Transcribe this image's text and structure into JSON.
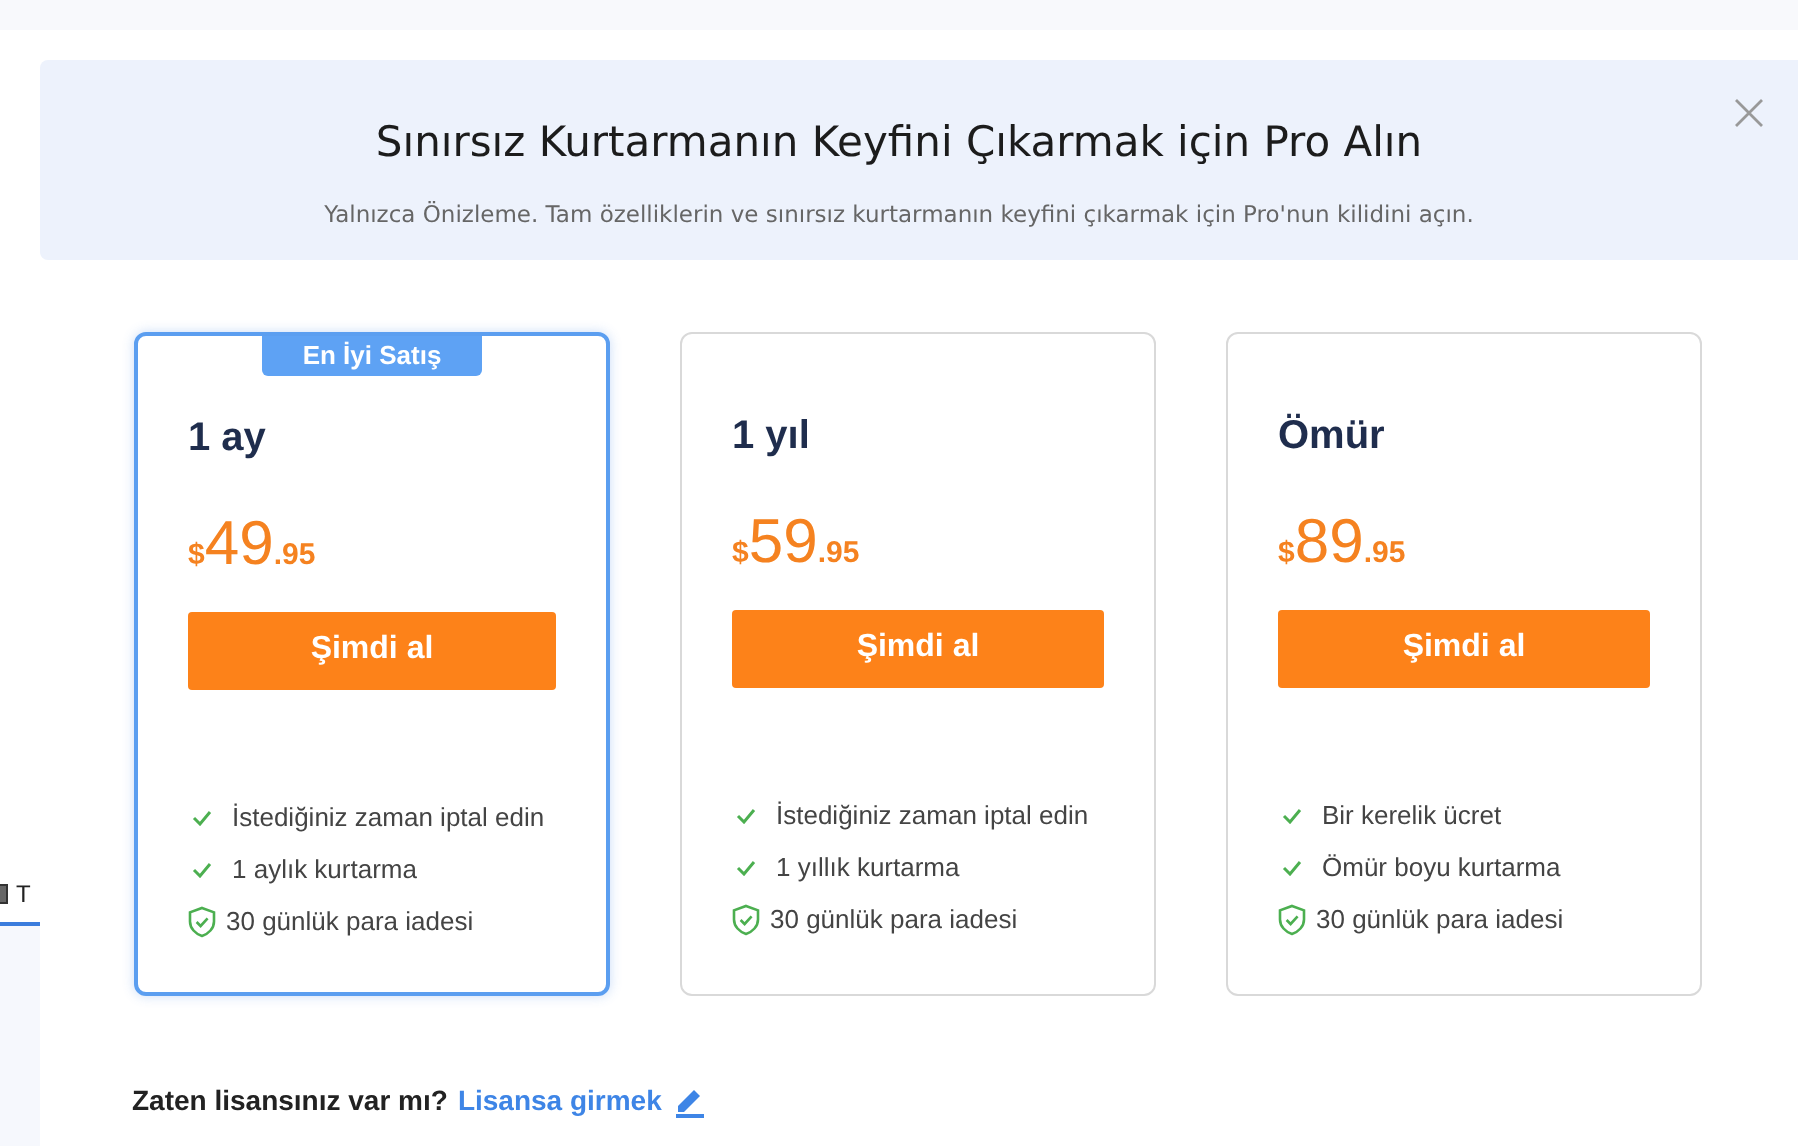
{
  "background": {
    "tab_label": "T"
  },
  "banner": {
    "title": "Sınırsız Kurtarmanın Keyfini Çıkarmak için Pro Alın",
    "subtitle": "Yalnızca Önizleme. Tam özelliklerin ve sınırsız kurtarmanın keyfini çıkarmak için Pro'nun kilidini açın."
  },
  "plans": [
    {
      "badge": "En İyi Satış",
      "selected": true,
      "name": "1 ay",
      "currency": "$",
      "price": "49",
      "cents": ".95",
      "button": "Şimdi al",
      "features": [
        {
          "kind": "check",
          "text": "İstediğiniz zaman iptal edin"
        },
        {
          "kind": "check",
          "text": "1 aylık kurtarma"
        },
        {
          "kind": "shield",
          "text": "30 günlük para iadesi"
        }
      ]
    },
    {
      "selected": false,
      "name": "1 yıl",
      "currency": "$",
      "price": "59",
      "cents": ".95",
      "button": "Şimdi al",
      "features": [
        {
          "kind": "check",
          "text": "İstediğiniz zaman iptal edin"
        },
        {
          "kind": "check",
          "text": "1 yıllık kurtarma"
        },
        {
          "kind": "shield",
          "text": "30 günlük para iadesi"
        }
      ]
    },
    {
      "selected": false,
      "name": "Ömür",
      "currency": "$",
      "price": "89",
      "cents": ".95",
      "button": "Şimdi al",
      "features": [
        {
          "kind": "check",
          "text": "Bir kerelik ücret"
        },
        {
          "kind": "check",
          "text": "Ömür boyu kurtarma"
        },
        {
          "kind": "shield",
          "text": "30 günlük para iadesi"
        }
      ]
    }
  ],
  "footer": {
    "question": "Zaten lisansınız var mı?",
    "link": "Lisansa girmek"
  }
}
